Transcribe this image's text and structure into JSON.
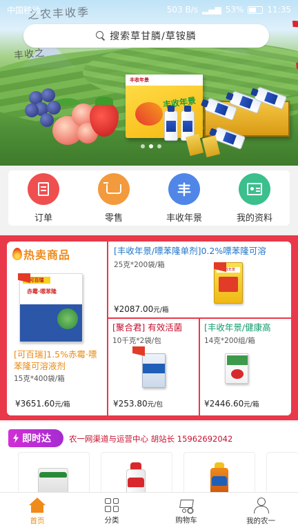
{
  "status_bar": {
    "carrier": "中国移动",
    "speed": "503 B/s",
    "battery": "53%",
    "time": "11:35"
  },
  "search": {
    "placeholder": "搜索草甘膦/草铵膦"
  },
  "banner": {
    "calligraphy_top": "之农丰收季",
    "calligraphy_side": "丰收之",
    "product_brand": "丰收年景",
    "box_label": "丰收年景",
    "page_count": 3,
    "active_page": 1
  },
  "quick_nav": [
    {
      "label": "订单",
      "icon": "order-icon",
      "color": "#ef4f4f"
    },
    {
      "label": "零售",
      "icon": "retail-cart-icon",
      "color": "#f39a3c"
    },
    {
      "label": "丰收年景",
      "icon": "harvest-icon",
      "glyph": "丰",
      "color": "#4f86e8"
    },
    {
      "label": "我的资料",
      "icon": "profile-card-icon",
      "color": "#3bbf8c"
    }
  ],
  "hot_section": {
    "title": "热卖商品",
    "products": [
      {
        "title": "[可百瑞]1.5%赤霉·嘌苯隆可溶液剂",
        "spec": "15克*400袋/箱",
        "price": "¥3651.60",
        "unit": "元/箱",
        "pkg_label": "可百瑞",
        "pkg_name": "赤霉·嘌苯隆"
      },
      {
        "title": "[丰收年景/嘌苯隆单剂]0.2%嘌苯隆可溶",
        "spec": "25克*200袋/箱",
        "price": "¥2087.00",
        "unit": "元/箱",
        "pkg_label": "丰收年景",
        "pkg_name": "嘌苯隆"
      },
      {
        "title": "[聚合君] 有效活菌",
        "spec": "10千克*2袋/包",
        "price": "¥253.80",
        "unit": "元/包"
      },
      {
        "title": "[丰收年景/健康高",
        "spec": "14克*200组/箱",
        "price": "¥2446.60",
        "unit": "元/箱"
      }
    ]
  },
  "instant": {
    "title": "即时达",
    "info": "农一网渠道与运营中心 胡站长 15962692042"
  },
  "tabbar": [
    {
      "label": "首页",
      "icon": "home-icon",
      "active": true
    },
    {
      "label": "分类",
      "icon": "category-grid-icon",
      "active": false
    },
    {
      "label": "购物车",
      "icon": "shopping-cart-icon",
      "active": false
    },
    {
      "label": "我的农一",
      "icon": "user-icon",
      "active": false
    }
  ],
  "colors": {
    "accent": "#f08a1a",
    "hot_bg": "#e8384a",
    "instant": "#c12fd5"
  }
}
